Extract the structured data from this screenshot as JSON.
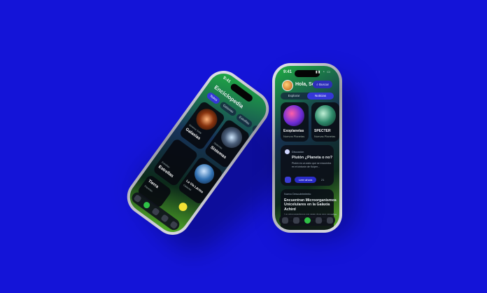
{
  "background": "#1414d8",
  "right_phone": {
    "status_time": "9:41",
    "status_icons": "▮▮ ◔ ▭",
    "greeting": "Hola, Sofia!",
    "search_label": "Buscar",
    "tabs": [
      {
        "label": "Explorar"
      },
      {
        "label": "Noticias"
      }
    ],
    "cards": [
      {
        "title": "Exoplanetas",
        "sub": "Nuevos Planetas"
      },
      {
        "title": "SPECTER",
        "sub": "Nuevas Planetas"
      }
    ],
    "discussion": {
      "tag": "Discusión",
      "title": "Plutón ¿Planeta o no?",
      "body": "Plutón es un astro que se encuentra en el cinturón de Kuiper...",
      "button": "Leer ahora",
      "count": "21"
    },
    "article": {
      "tag": "Nuevo Descubrimiento",
      "title": "Encuentran Microorganismos Unicelulares en la Galaxia Achird",
      "body": "Los microorganismos son seres vivos muy pequeños que sólo se pueden ver a través de un microscopio, estos organismos pueden ser unicelulares..."
    }
  },
  "left_phone": {
    "status_time": "9:41",
    "title": "Enciclopedia",
    "chips": [
      {
        "label": "Todos"
      },
      {
        "label": "Galaxias"
      },
      {
        "label": "Estrellas"
      },
      {
        "label": "Planetas"
      }
    ],
    "grid": [
      {
        "title": "Galaxias",
        "sub": "Sistema Solar"
      },
      {
        "title": "Sistemas",
        "sub": "Sistemas"
      },
      {
        "title": "Estrellas",
        "sub": "Estrellas"
      },
      {
        "title": "La Vía Láctea",
        "sub": "Galaxias"
      },
      {
        "title": "Tierra",
        "sub": "Planetas"
      }
    ]
  }
}
